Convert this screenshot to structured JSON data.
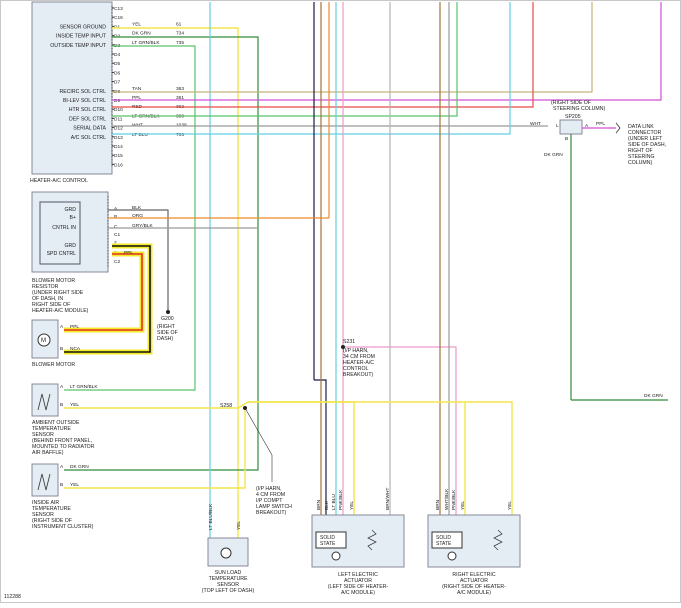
{
  "hvac_module": {
    "title": "HEATER-A/C CONTROL",
    "pin_labels": [
      "C13",
      "C16",
      "D1",
      "D2",
      "D3",
      "D4",
      "D5",
      "D6",
      "D7",
      "D8",
      "D9",
      "D10",
      "D11",
      "D12",
      "D13",
      "D14",
      "D15",
      "D16"
    ],
    "signals": [
      {
        "name": "SENSOR GROUND",
        "pin": "D1",
        "wire": "YEL",
        "circuit": "61"
      },
      {
        "name": "INSIDE TEMP INPUT",
        "pin": "D2",
        "wire": "DK GRN",
        "circuit": "734"
      },
      {
        "name": "OUTSIDE TEMP INPUT",
        "pin": "D3",
        "wire": "LT GRN/BLK",
        "circuit": "735"
      },
      {
        "name": "RECIRC SOL CTRL",
        "pin": "D8",
        "wire": "TAN",
        "circuit": "363"
      },
      {
        "name": "BI-LEV SOL CTRL",
        "pin": "D9",
        "wire": "PPL",
        "circuit": "361"
      },
      {
        "name": "HTR SOL CTRL",
        "pin": "D10",
        "wire": "RED",
        "circuit": "362"
      },
      {
        "name": "DEF SOL CTRL",
        "pin": "D11",
        "wire": "LT GRN/BLK",
        "circuit": "360"
      },
      {
        "name": "SERIAL DATA",
        "pin": "D12",
        "wire": "WHT",
        "circuit": "1038"
      },
      {
        "name": "A/C SOL CTRL",
        "pin": "D13",
        "wire": "LT BLU",
        "circuit": "706"
      }
    ]
  },
  "blower_resistor": {
    "labels": [
      "GRD",
      "B+",
      "CNTRL IN",
      "GRD",
      "SPD CNTRL"
    ],
    "pins": [
      "A",
      "B",
      "C",
      "C1",
      "2",
      "1",
      "C2"
    ],
    "wires": [
      "BLK",
      "ORG",
      "GRY/BLK",
      "PPL"
    ],
    "caption": [
      "BLOWER MOTOR",
      "RESISTOR",
      "(UNDER RIGHT SIDE",
      "OF DASH, IN",
      "RIGHT SIDE OF",
      "HEATER-A/C MODULE)"
    ]
  },
  "ground": {
    "name": "G200",
    "caption": [
      "(RIGHT",
      "SIDE OF",
      "DASH)"
    ]
  },
  "blower_motor": {
    "pin_a": "A",
    "wire_a": "PPL",
    "pin_b": "B",
    "wire_b": "NCA",
    "caption": "BLOWER MOTOR"
  },
  "ambient_sensor": {
    "pin_a": "A",
    "wire_a": "LT GRN/BLK",
    "pin_b": "B",
    "wire_b": "YEL",
    "caption": [
      "AMBIENT OUTSIDE",
      "TEMPERATURE",
      "SENSOR",
      "(BEHIND FRONT PANEL,",
      "MOUNTED TO RADIATOR",
      "AIR BAFFLE)"
    ]
  },
  "inside_sensor": {
    "pin_a": "A",
    "wire_a": "DK GRN",
    "pin_b": "B",
    "wire_b": "YEL",
    "caption": [
      "INSIDE AIR",
      "TEMPERATURE",
      "SENSOR",
      "(RIGHT SIDE OF",
      "INSTRUMENT CLUSTER)"
    ]
  },
  "splice_s258": {
    "name": "S258",
    "caption": [
      "(I/P HARN,",
      "4 CM FROM",
      "I/P COMPT",
      "LAMP SWITCH",
      "BREAKOUT)"
    ]
  },
  "splice_s231": {
    "name": "S231",
    "caption": [
      "(I/P HARN,",
      "34 CM FROM",
      "HEATER-A/C",
      "CONTROL",
      "BREAKOUT)"
    ]
  },
  "splice_sp205": {
    "name": "SP205",
    "caption": [
      "(RIGHT SIDE OF",
      "STEERING COLUMN)"
    ],
    "wire_left": "WHT",
    "wire_right": "PPL",
    "wire_down": "DK GRN",
    "pins": [
      "L",
      "A",
      "B"
    ]
  },
  "dlc": {
    "caption": [
      "DATA LINK",
      "CONNECTOR",
      "(UNDER LEFT",
      "SIDE OF DASH,",
      "RIGHT OF",
      "STEERING",
      "COLUMN)"
    ]
  },
  "dk_grn_right": "DK GRN",
  "sun_sensor": {
    "wires": [
      "LT BLU/BLK",
      "YEL"
    ],
    "caption": [
      "SUN LOAD",
      "TEMPERATURE",
      "SENSOR",
      "(TOP LEFT OF DASH)"
    ]
  },
  "left_actuator": {
    "wires": [
      "BRN",
      "BLK",
      "LT BLU",
      "PNK/BLK",
      "YEL",
      "BRN/WHT"
    ],
    "inner": "SOLID\nSTATE",
    "caption": [
      "LEFT ELECTRIC",
      "ACTUATOR",
      "(LEFT SIDE OF HEATER-",
      "A/C MODULE)"
    ]
  },
  "right_actuator": {
    "wires": [
      "BRN",
      "WHT/BLK",
      "PNK/BLK",
      "YEL",
      "YEL"
    ],
    "inner": "SOLID\nSTATE",
    "caption": [
      "RIGHT ELECTRIC",
      "ACTUATOR",
      "(RIGHT SIDE OF HEATER-",
      "A/C MODULE)"
    ]
  },
  "figure_id": "112288"
}
